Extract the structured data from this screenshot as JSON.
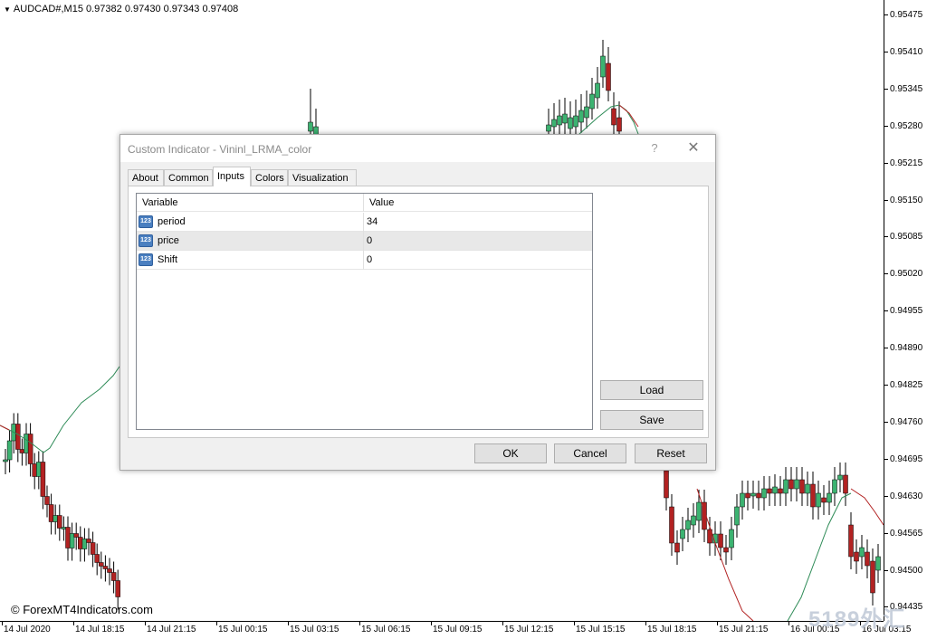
{
  "chart": {
    "symbol_line": "AUDCAD#,M15  0.97382 0.97430 0.97343 0.97408",
    "price_labels": [
      "0.95475",
      "0.95410",
      "0.95345",
      "0.95280",
      "0.95215",
      "0.95150",
      "0.95085",
      "0.95020",
      "0.94955",
      "0.94890",
      "0.94825",
      "0.94760",
      "0.94695",
      "0.94630",
      "0.94565",
      "0.94500",
      "0.94435"
    ],
    "time_labels": [
      "14 Jul 2020",
      "14 Jul 18:15",
      "14 Jul 21:15",
      "15 Jul 00:15",
      "15 Jul 03:15",
      "15 Jul 06:15",
      "15 Jul 09:15",
      "15 Jul 12:15",
      "15 Jul 15:15",
      "15 Jul 18:15",
      "15 Jul 21:15",
      "16 Jul 00:15",
      "16 Jul 03:15"
    ],
    "copyright": "© ForexMT4Indicators.com",
    "watermark": "5189外汇网",
    "colors": {
      "bull": "#3cb371",
      "bear": "#b22222",
      "line_up": "#2e8b57",
      "line_down": "#b22222"
    }
  },
  "dialog": {
    "title": "Custom Indicator - Vininl_LRMA_color",
    "help_label": "?",
    "close_label": "✕",
    "tabs": [
      {
        "label": "About",
        "active": false
      },
      {
        "label": "Common",
        "active": false
      },
      {
        "label": "Inputs",
        "active": true
      },
      {
        "label": "Colors",
        "active": false
      },
      {
        "label": "Visualization",
        "active": false
      }
    ],
    "table": {
      "headers": [
        "Variable",
        "Value"
      ],
      "rows": [
        {
          "icon": "123",
          "name": "period",
          "value": "34"
        },
        {
          "icon": "123",
          "name": "price",
          "value": "0"
        },
        {
          "icon": "123",
          "name": "Shift",
          "value": "0"
        }
      ]
    },
    "buttons": {
      "load": "Load",
      "save": "Save",
      "ok": "OK",
      "cancel": "Cancel",
      "reset": "Reset"
    }
  }
}
